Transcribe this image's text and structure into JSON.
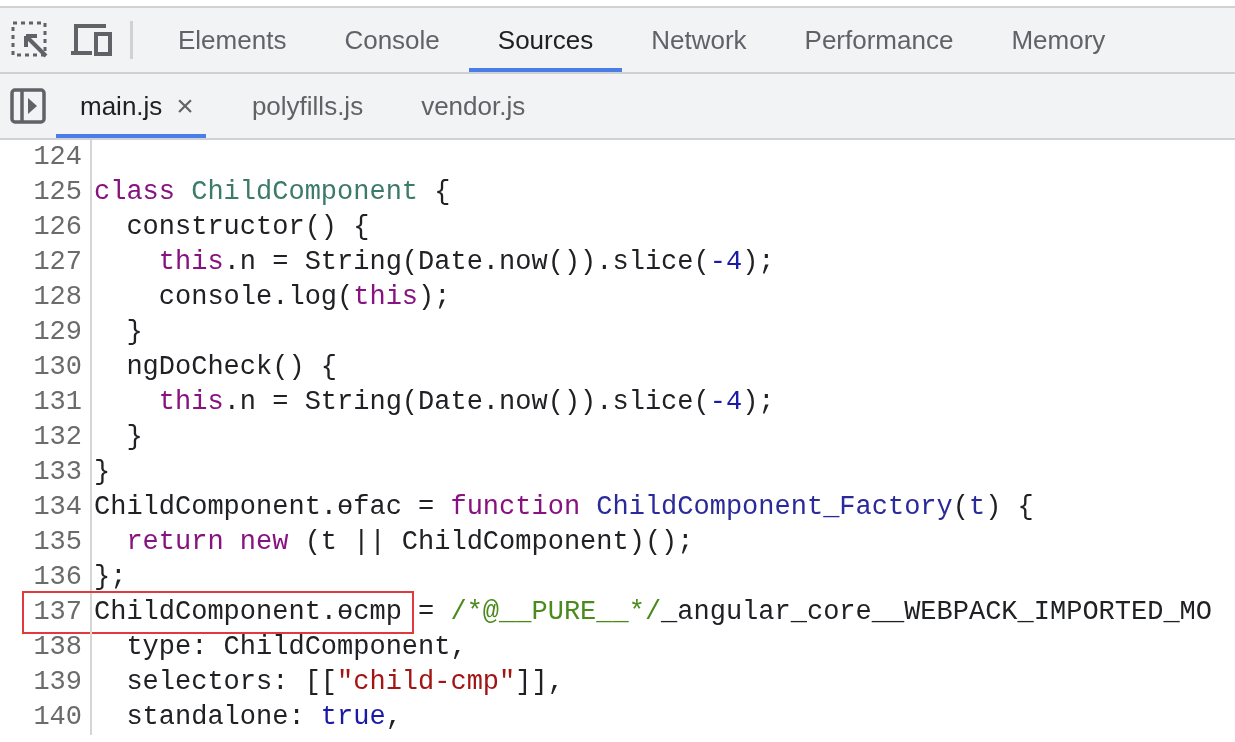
{
  "panel_tabs": [
    {
      "label": "Elements",
      "selected": false
    },
    {
      "label": "Console",
      "selected": false
    },
    {
      "label": "Sources",
      "selected": true
    },
    {
      "label": "Network",
      "selected": false
    },
    {
      "label": "Performance",
      "selected": false
    },
    {
      "label": "Memory",
      "selected": false
    }
  ],
  "file_tabs": [
    {
      "label": "main.js",
      "selected": true,
      "closable": true
    },
    {
      "label": "polyfills.js",
      "selected": false,
      "closable": false
    },
    {
      "label": "vendor.js",
      "selected": false,
      "closable": false
    }
  ],
  "close_glyph": "×",
  "lines": [
    {
      "number": "124",
      "highlighted": false
    },
    {
      "number": "125",
      "highlighted": false,
      "tokens": [
        {
          "text": "class ",
          "kind": "keyword"
        },
        {
          "text": "ChildComponent",
          "kind": "class"
        },
        {
          "text": " {",
          "kind": "plain"
        }
      ]
    },
    {
      "number": "126",
      "highlighted": false,
      "tokens": [
        {
          "text": "  constructor() {",
          "kind": "plain"
        }
      ]
    },
    {
      "number": "127",
      "highlighted": false,
      "tokens": [
        {
          "text": "    this",
          "kind": "keyword"
        },
        {
          "text": ".n = String(Date.now()).slice(",
          "kind": "plain"
        },
        {
          "text": "-4",
          "kind": "number"
        },
        {
          "text": ");",
          "kind": "plain"
        }
      ]
    },
    {
      "number": "128",
      "highlighted": false,
      "tokens": [
        {
          "text": "    console.log(",
          "kind": "plain"
        },
        {
          "text": "this",
          "kind": "keyword"
        },
        {
          "text": ");",
          "kind": "plain"
        }
      ]
    },
    {
      "number": "129",
      "highlighted": false,
      "tokens": [
        {
          "text": "  }",
          "kind": "plain"
        }
      ]
    },
    {
      "number": "130",
      "highlighted": false,
      "tokens": [
        {
          "text": "  ngDoCheck() {",
          "kind": "plain"
        }
      ]
    },
    {
      "number": "131",
      "highlighted": false,
      "tokens": [
        {
          "text": "    this",
          "kind": "keyword"
        },
        {
          "text": ".n = String(Date.now()).slice(",
          "kind": "plain"
        },
        {
          "text": "-4",
          "kind": "number"
        },
        {
          "text": ");",
          "kind": "plain"
        }
      ]
    },
    {
      "number": "132",
      "highlighted": false,
      "tokens": [
        {
          "text": "  }",
          "kind": "plain"
        }
      ]
    },
    {
      "number": "133",
      "highlighted": false,
      "tokens": [
        {
          "text": "}",
          "kind": "plain"
        }
      ]
    },
    {
      "number": "134",
      "highlighted": false,
      "tokens": [
        {
          "text": "ChildComponent.ɵfac = ",
          "kind": "plain"
        },
        {
          "text": "function ",
          "kind": "keyword"
        },
        {
          "text": "ChildComponent_Factory",
          "kind": "function"
        },
        {
          "text": "(",
          "kind": "plain"
        },
        {
          "text": "t",
          "kind": "function"
        },
        {
          "text": ") {",
          "kind": "plain"
        }
      ]
    },
    {
      "number": "135",
      "highlighted": false,
      "tokens": [
        {
          "text": "  return new",
          "kind": "keyword"
        },
        {
          "text": " (t || ChildComponent)();",
          "kind": "plain"
        }
      ]
    },
    {
      "number": "136",
      "highlighted": false,
      "tokens": [
        {
          "text": "};",
          "kind": "plain"
        }
      ]
    },
    {
      "number": "137",
      "highlighted": true,
      "tokens": [
        {
          "text": "ChildComponent.ɵcmp = ",
          "kind": "plain"
        },
        {
          "text": "/*@__PURE__*/",
          "kind": "comment"
        },
        {
          "text": "_angular_core__WEBPACK_IMPORTED_MO",
          "kind": "plain"
        }
      ]
    },
    {
      "number": "138",
      "highlighted": false,
      "tokens": [
        {
          "text": "  type: ChildComponent,",
          "kind": "plain"
        }
      ]
    },
    {
      "number": "139",
      "highlighted": false,
      "tokens": [
        {
          "text": "  selectors: [[",
          "kind": "plain"
        },
        {
          "text": "\"child-cmp\"",
          "kind": "string"
        },
        {
          "text": "]],",
          "kind": "plain"
        }
      ]
    },
    {
      "number": "140",
      "highlighted": false,
      "tokens": [
        {
          "text": "  standalone: ",
          "kind": "plain"
        },
        {
          "text": "true",
          "kind": "literal"
        },
        {
          "text": ",",
          "kind": "plain"
        }
      ]
    }
  ]
}
